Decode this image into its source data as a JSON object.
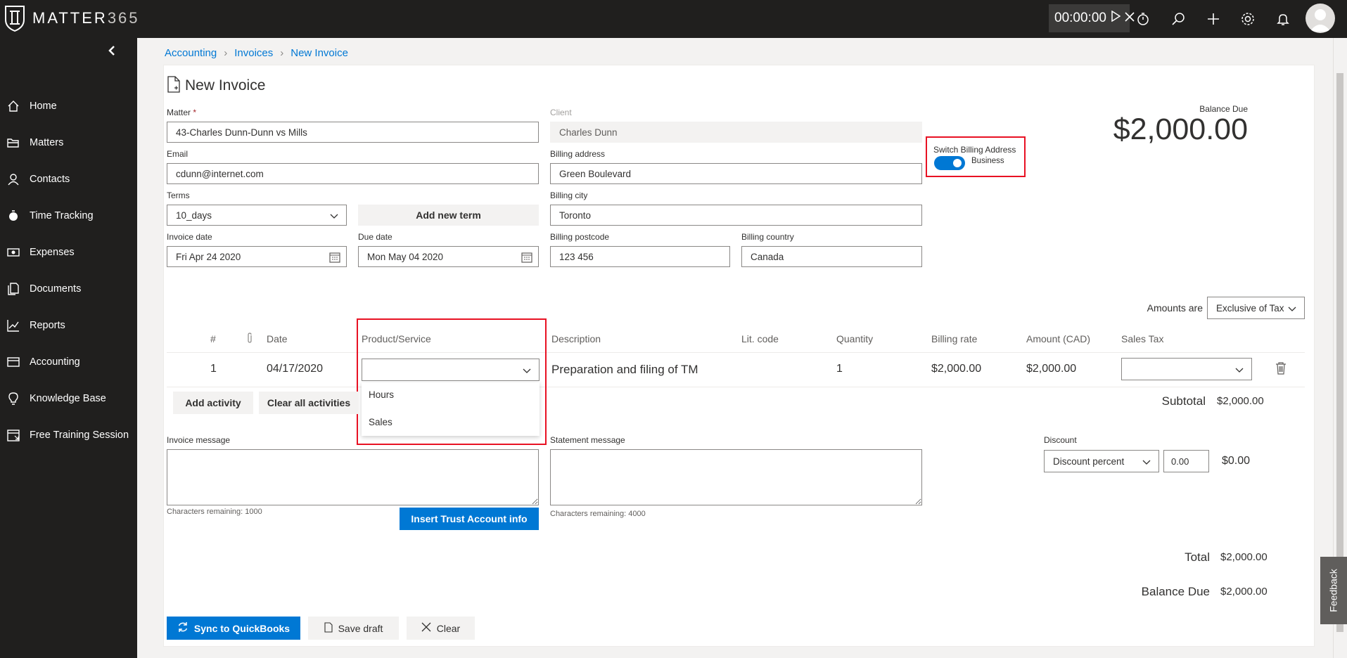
{
  "app": {
    "logo_main": "MATTER",
    "logo_num": "365"
  },
  "topbar": {
    "timer": "00:00:00",
    "icons": [
      "play-icon",
      "stop-icon",
      "stopwatch-icon",
      "search-icon",
      "plus-icon",
      "gear-icon",
      "bell-icon",
      "avatar"
    ]
  },
  "sidebar": {
    "items": [
      {
        "label": "Home",
        "icon": "home-icon"
      },
      {
        "label": "Matters",
        "icon": "folder-icon"
      },
      {
        "label": "Contacts",
        "icon": "person-icon"
      },
      {
        "label": "Time Tracking",
        "icon": "stopwatch-icon"
      },
      {
        "label": "Expenses",
        "icon": "money-icon"
      },
      {
        "label": "Documents",
        "icon": "documents-icon"
      },
      {
        "label": "Reports",
        "icon": "chart-icon"
      },
      {
        "label": "Accounting",
        "icon": "wallet-icon"
      },
      {
        "label": "Knowledge Base",
        "icon": "lightbulb-icon"
      },
      {
        "label": "Free Training Session",
        "icon": "calendar-icon"
      }
    ]
  },
  "breadcrumb": [
    "Accounting",
    "Invoices",
    "New Invoice"
  ],
  "page": {
    "title": "New Invoice"
  },
  "form": {
    "matter_label": "Matter",
    "required_mark": "*",
    "matter_value": "43-Charles Dunn-Dunn vs Mills",
    "email_label": "Email",
    "email_value": "cdunn@internet.com",
    "terms_label": "Terms",
    "terms_value": "10_days",
    "add_term": "Add new term",
    "invoice_date_label": "Invoice date",
    "invoice_date_value": "Fri Apr 24 2020",
    "due_date_label": "Due date",
    "due_date_value": "Mon May 04 2020",
    "client_label": "Client",
    "client_value": "Charles Dunn",
    "billing_address_label": "Billing address",
    "billing_address_value": "Green Boulevard",
    "billing_city_label": "Billing city",
    "billing_city_value": "Toronto",
    "billing_postcode_label": "Billing postcode",
    "billing_postcode_value": "123 456",
    "billing_country_label": "Billing country",
    "billing_country_value": "Canada",
    "switch_label": "Switch Billing Address",
    "switch_state_label": "Business",
    "balance_due_label": "Balance Due",
    "balance_due_value": "$2,000.00"
  },
  "table": {
    "amounts_are_label": "Amounts are",
    "amounts_are_value": "Exclusive of Tax",
    "headers": {
      "num": "#",
      "date": "Date",
      "product": "Product/Service",
      "description": "Description",
      "lit_code": "Lit. code",
      "quantity": "Quantity",
      "billing_rate": "Billing rate",
      "amount": "Amount (CAD)",
      "sales_tax": "Sales Tax"
    },
    "rows": [
      {
        "num": "1",
        "date": "04/17/2020",
        "product": "",
        "description": "Preparation and filing of TM",
        "lit_code": "",
        "quantity": "1",
        "billing_rate": "$2,000.00",
        "amount": "$2,000.00",
        "sales_tax": ""
      }
    ],
    "product_options": [
      "Hours",
      "Sales"
    ],
    "add_activity": "Add activity",
    "clear_all": "Clear all activities"
  },
  "totals": {
    "subtotal_label": "Subtotal",
    "subtotal_value": "$2,000.00",
    "discount_label": "Discount",
    "discount_type": "Discount percent",
    "discount_input": "0.00",
    "discount_amount": "$0.00",
    "total_label": "Total",
    "total_value": "$2,000.00",
    "balance_due_label": "Balance Due",
    "balance_due_value": "$2,000.00"
  },
  "messages": {
    "invoice_label": "Invoice message",
    "invoice_remaining": "Characters remaining: 1000",
    "insert_trust": "Insert Trust Account info",
    "statement_label": "Statement message",
    "statement_remaining": "Characters remaining: 4000"
  },
  "actions": {
    "sync": "Sync to QuickBooks",
    "save_draft": "Save draft",
    "clear": "Clear"
  },
  "feedback": "Feedback",
  "colors": {
    "accent": "#0078d4",
    "highlight": "#e81123",
    "sidebar": "#201f1e"
  }
}
